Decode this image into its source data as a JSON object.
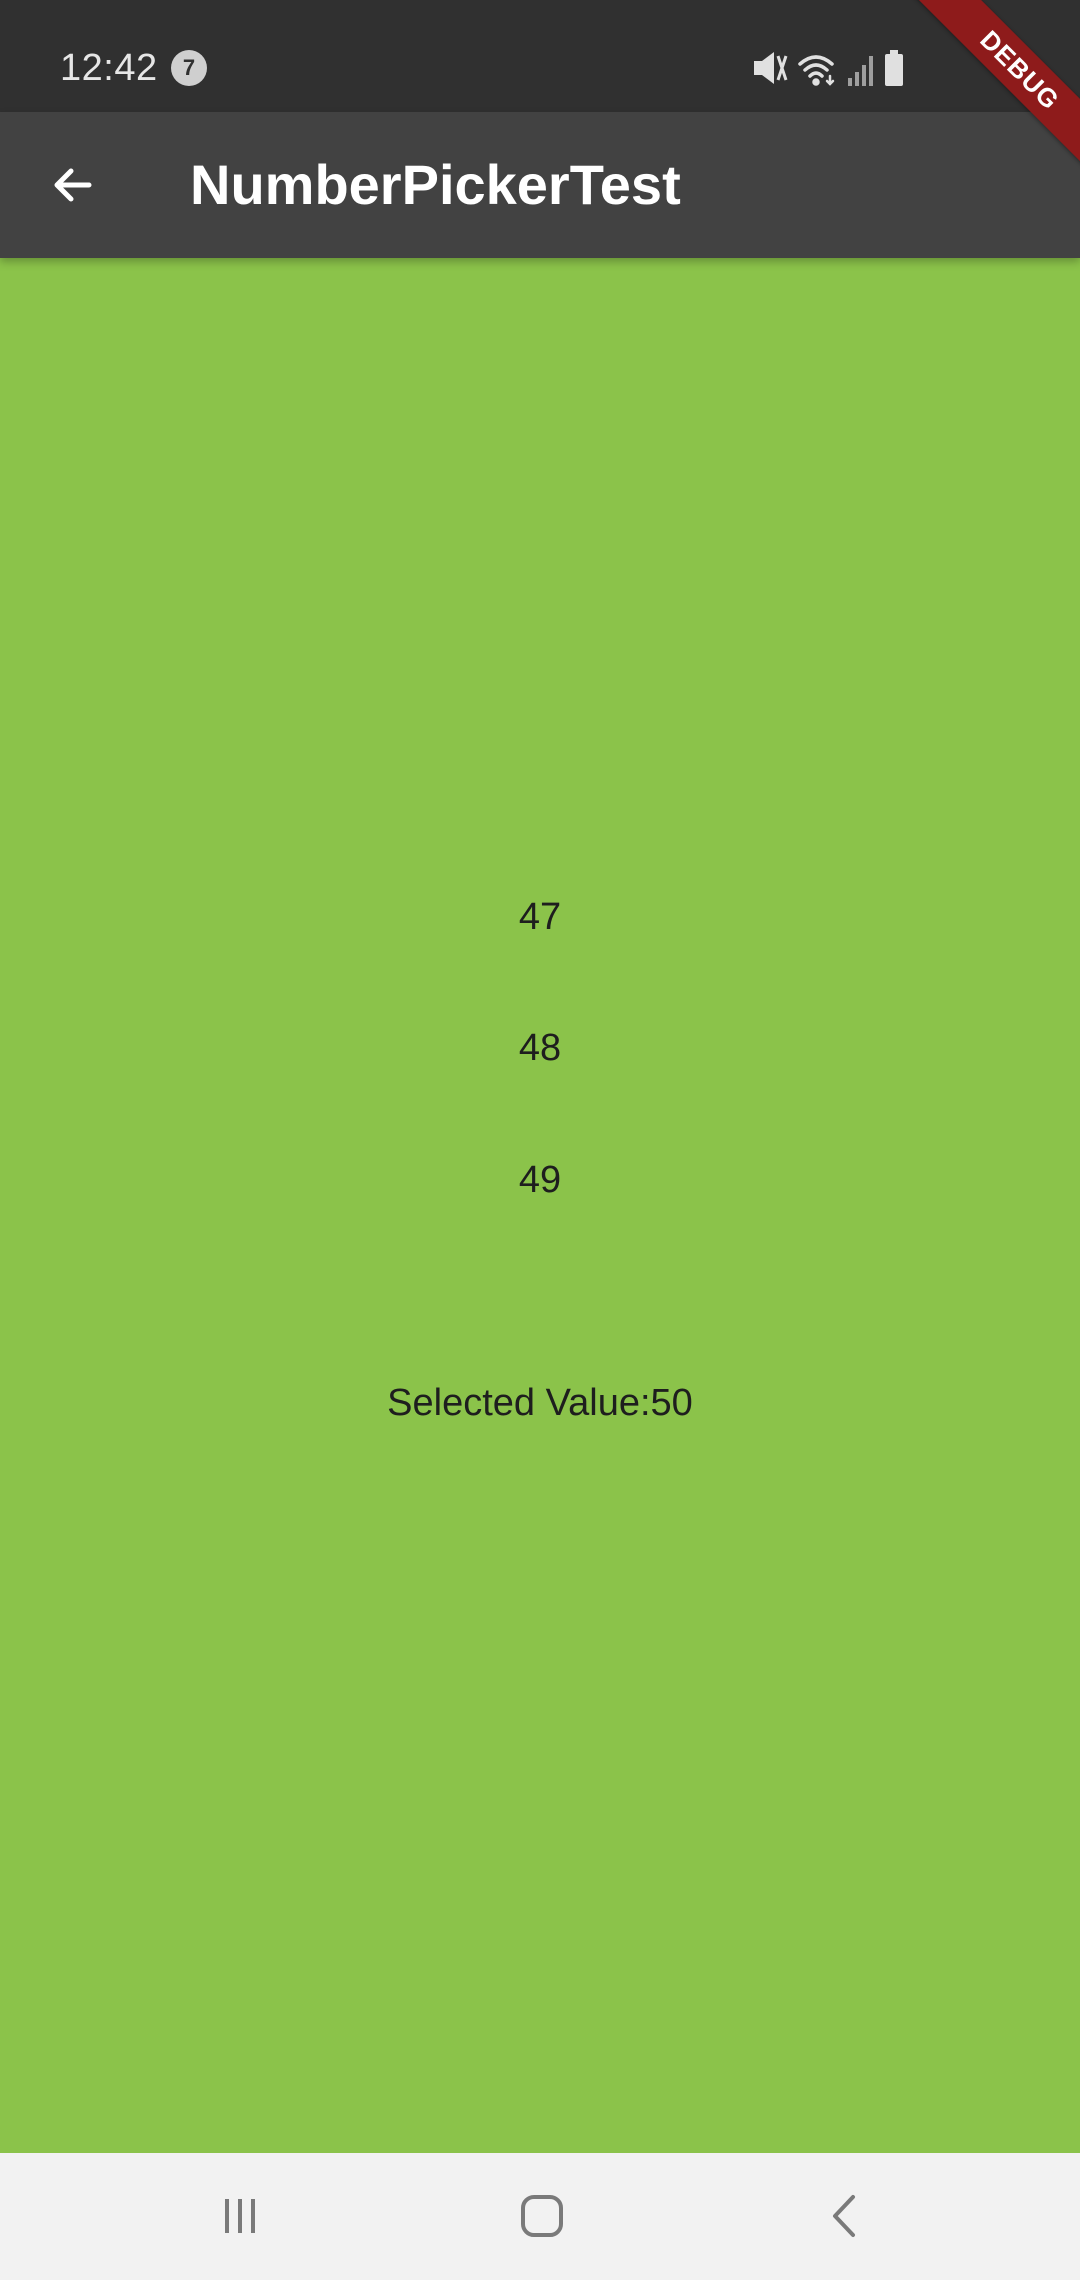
{
  "status_bar": {
    "time": "12:42",
    "notification_count": "7",
    "icons": [
      "mute-icon",
      "wifi-icon",
      "signal-icon",
      "battery-icon"
    ]
  },
  "app_bar": {
    "back_icon": "arrow-back-icon",
    "title": "NumberPickerTest"
  },
  "debug_banner": {
    "label": "DEBUG"
  },
  "picker": {
    "items": [
      "47",
      "48",
      "49"
    ]
  },
  "selected": {
    "text": "Selected Value:50"
  },
  "nav_bar": {
    "icons": [
      "recent-apps-icon",
      "home-icon",
      "back-icon"
    ]
  },
  "colors": {
    "background": "#8bc34a",
    "app_bar": "#424242",
    "status_bar": "#303030",
    "debug_banner": "#8e1b1b"
  }
}
